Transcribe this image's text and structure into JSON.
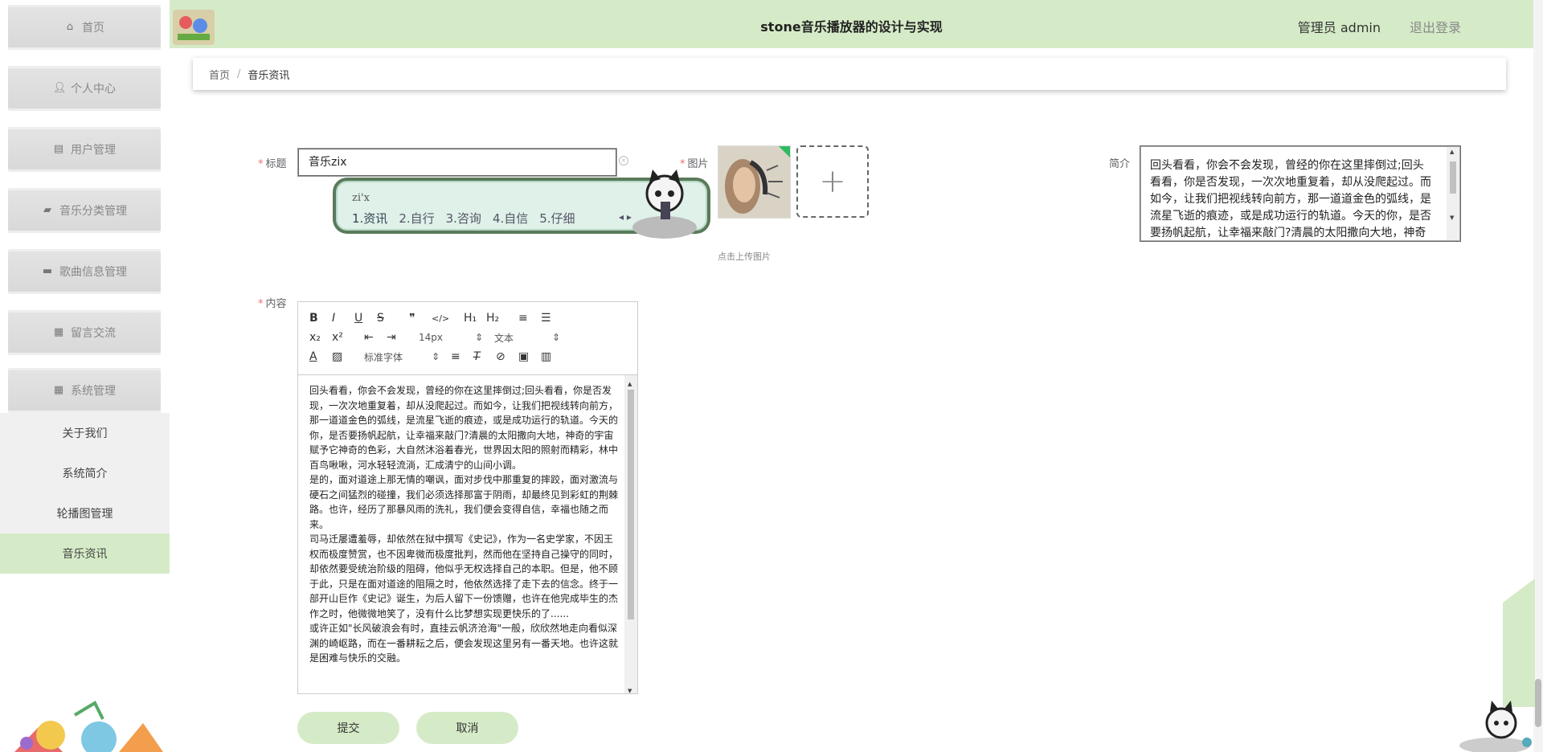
{
  "header": {
    "title": "stone音乐播放器的设计与实现",
    "user": "管理员 admin",
    "logout": "退出登录"
  },
  "sidebar": {
    "items": [
      {
        "label": "首页",
        "icon": "home-icon"
      },
      {
        "label": "个人中心",
        "icon": "user-icon"
      },
      {
        "label": "用户管理",
        "icon": "clipboard-icon"
      },
      {
        "label": "音乐分类管理",
        "icon": "truck-icon"
      },
      {
        "label": "歌曲信息管理",
        "icon": "chat-icon"
      },
      {
        "label": "留言交流",
        "icon": "grid-icon"
      },
      {
        "label": "系统管理",
        "icon": "grid-icon"
      }
    ],
    "sub_items": [
      "关于我们",
      "系统简介",
      "轮播图管理",
      "音乐资讯"
    ],
    "active_sub": "音乐资讯"
  },
  "breadcrumb": {
    "home": "首页",
    "separator": "/",
    "current": "音乐资讯"
  },
  "form": {
    "title_label": "标题",
    "title_value": "音乐zix",
    "image_label": "图片",
    "upload_tip": "点击上传图片",
    "intro_label": "简介",
    "intro_text": "回头看看，你会不会发现，曾经的你在这里摔倒过;回头看看，你是否发现，一次次地重复着，却从没爬起过。而如今，让我们把视线转向前方，那一道道金色的弧线，是流星飞逝的痕迹，或是成功运行的轨道。今天的你，是否要扬帆起航，让幸福来敲门?清晨的太阳撒向大地，神奇",
    "content_label": "内容",
    "content_paragraphs": [
      "回头看看，你会不会发现，曾经的你在这里摔倒过;回头看看，你是否发现，一次次地重复着，却从没爬起过。而如今，让我们把视线转向前方，那一道道金色的弧线，是流星飞逝的痕迹，或是成功运行的轨道。今天的你，是否要扬帆起航，让幸福来敲门?清晨的太阳撒向大地，神奇的宇宙赋予它神奇的色彩，大自然沐浴着春光，世界因太阳的照射而精彩，林中百鸟啾啾，河水轻轻流淌，汇成清宁的山间小调。",
      "是的，面对道途上那无情的嘲讽，面对步伐中那重复的摔跤，面对激流与硬石之间猛烈的碰撞，我们必须选择那富于阴雨，却最终见到彩虹的荆棘路。也许，经历了那暴风雨的洗礼，我们便会变得自信，幸福也随之而来。",
      "司马迁屡遭羞辱，却依然在狱中撰写《史记》，作为一名史学家，不因王权而极度赞赏，也不因卑微而极度批判，然而他在坚持自己操守的同时，却依然要受统治阶级的阻碍，他似乎无权选择自己的本职。但是，他不顾于此，只是在面对道途的阻隔之时，他依然选择了走下去的信念。终于一部开山巨作《史记》诞生，为后人留下一份馈赠，也许在他完成毕生的杰作之时，他微微地笑了，没有什么比梦想实现更快乐的了......",
      "或许正如\"长风破浪会有时，直挂云帆济沧海\"一般，欣欣然地走向看似深渊的崎岖路，而在一番耕耘之后，便会发现这里另有一番天地。也许这就是困难与快乐的交融。"
    ],
    "submit": "提交",
    "cancel": "取消"
  },
  "editor_toolbar": {
    "size_select": "14px",
    "header_select": "文本",
    "font_select": "标准字体",
    "row1": [
      "B",
      "I",
      "U",
      "S",
      "❞",
      "</>",
      "H₁",
      "H₂",
      "≡",
      "☰"
    ],
    "row2": [
      "x₂",
      "x²"
    ]
  },
  "ime": {
    "pinyin": "zi'x",
    "candidates": [
      "1.资讯",
      "2.自行",
      "3.咨询",
      "4.自信",
      "5.仔细"
    ]
  },
  "colors": {
    "accent": "#d5ebc7",
    "required": "#f56c6c"
  }
}
